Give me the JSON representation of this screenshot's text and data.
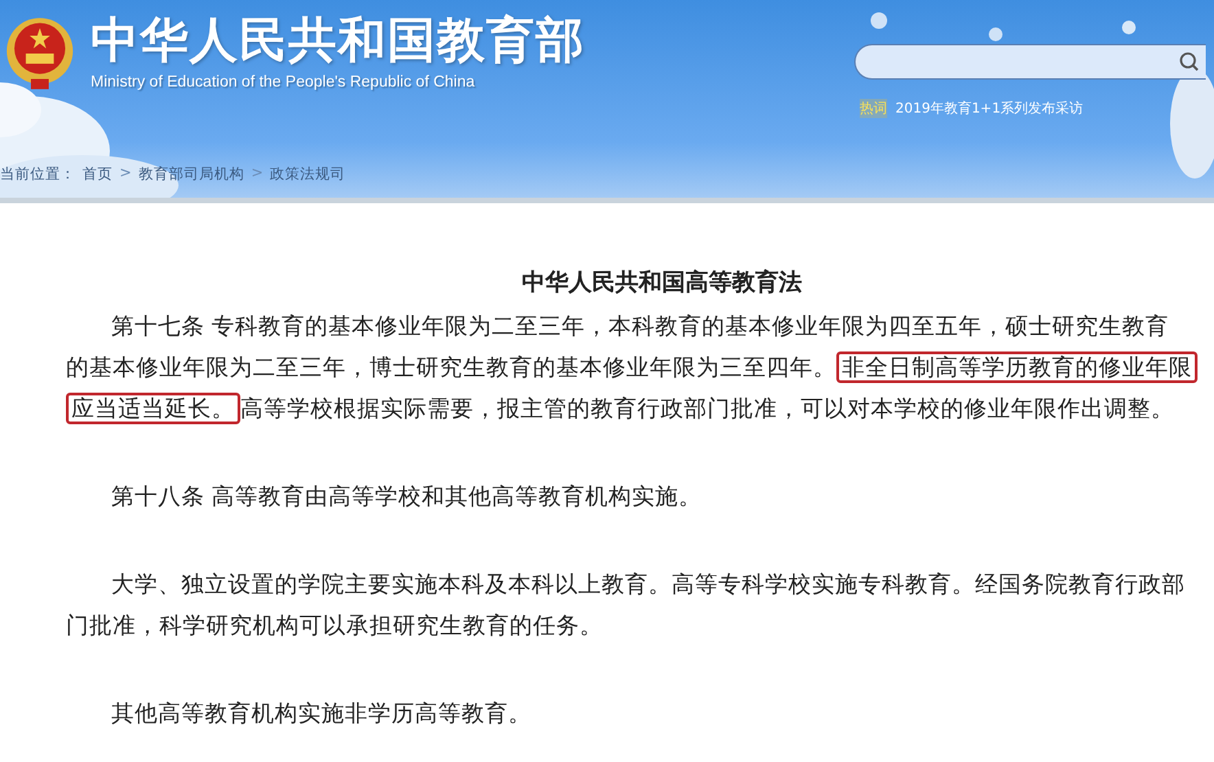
{
  "header": {
    "site_title": "中华人民共和国教育部",
    "site_subtitle": "Ministry of Education of the People's Republic of China",
    "hot": {
      "label": "热词",
      "link": "2019年教育1+1系列发布采访"
    }
  },
  "breadcrumb": {
    "label": "当前位置：",
    "items": [
      {
        "text": "首页"
      },
      {
        "text": "教育部司局机构"
      },
      {
        "text": "政策法规司"
      }
    ],
    "separator": ">"
  },
  "article": {
    "title": "中华人民共和国高等教育法",
    "paragraphs": [
      {
        "parts": [
          {
            "text": "第十七条 专科教育的基本修业年限为二至三年，本科教育的基本修业年限为四至五年，硕士研究生教育的基本修业年限为二至三年，博士研究生教育的基本修业年限为三至四年。",
            "highlighted": false
          },
          {
            "text": "非全日制高等学历教育的修业年限应当适当延长。",
            "highlighted": true
          },
          {
            "text": "高等学校根据实际需要，报主管的教育行政部门批准，可以对本学校的修业年限作出调整。",
            "highlighted": false
          }
        ]
      },
      {
        "parts": [
          {
            "text": "第十八条 高等教育由高等学校和其他高等教育机构实施。",
            "highlighted": false
          }
        ]
      },
      {
        "parts": [
          {
            "text": "大学、独立设置的学院主要实施本科及本科以上教育。高等专科学校实施专科教育。经国务院教育行政部门批准，科学研究机构可以承担研究生教育的任务。",
            "highlighted": false
          }
        ]
      },
      {
        "parts": [
          {
            "text": "其他高等教育机构实施非学历高等教育。",
            "highlighted": false
          }
        ]
      }
    ]
  }
}
